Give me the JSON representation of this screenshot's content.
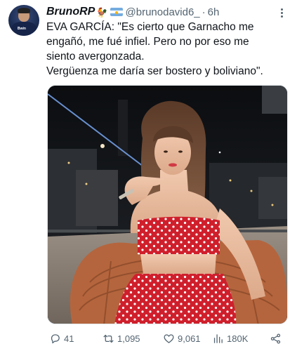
{
  "author": {
    "display_name": "BrunoRP",
    "name_emoji": "🐓",
    "flag_name": "argentina-flag",
    "handle": "@brunodavid6_",
    "separator": "·",
    "timestamp": "6h",
    "avatar_sponsor_text": "Bwin"
  },
  "tweet": {
    "lines": [
      "EVA GARCÍA: \"Es cierto que Garnacho me",
      "engañó, me fué infiel. Pero no por eso me",
      "siento avergonzada.",
      "Vergüenza me daría ser bostero y boliviano\"."
    ]
  },
  "media": {
    "kind": "photo",
    "dress_color": "#d3202e",
    "dot_color": "#ffffff"
  },
  "actions": {
    "replies": "41",
    "retweets": "1,095",
    "likes": "9,061",
    "views": "180K"
  },
  "icons": {
    "more": "more-dots-icon",
    "reply": "reply-icon",
    "retweet": "retweet-icon",
    "like": "heart-icon",
    "views": "views-chart-icon",
    "share": "share-icon"
  }
}
